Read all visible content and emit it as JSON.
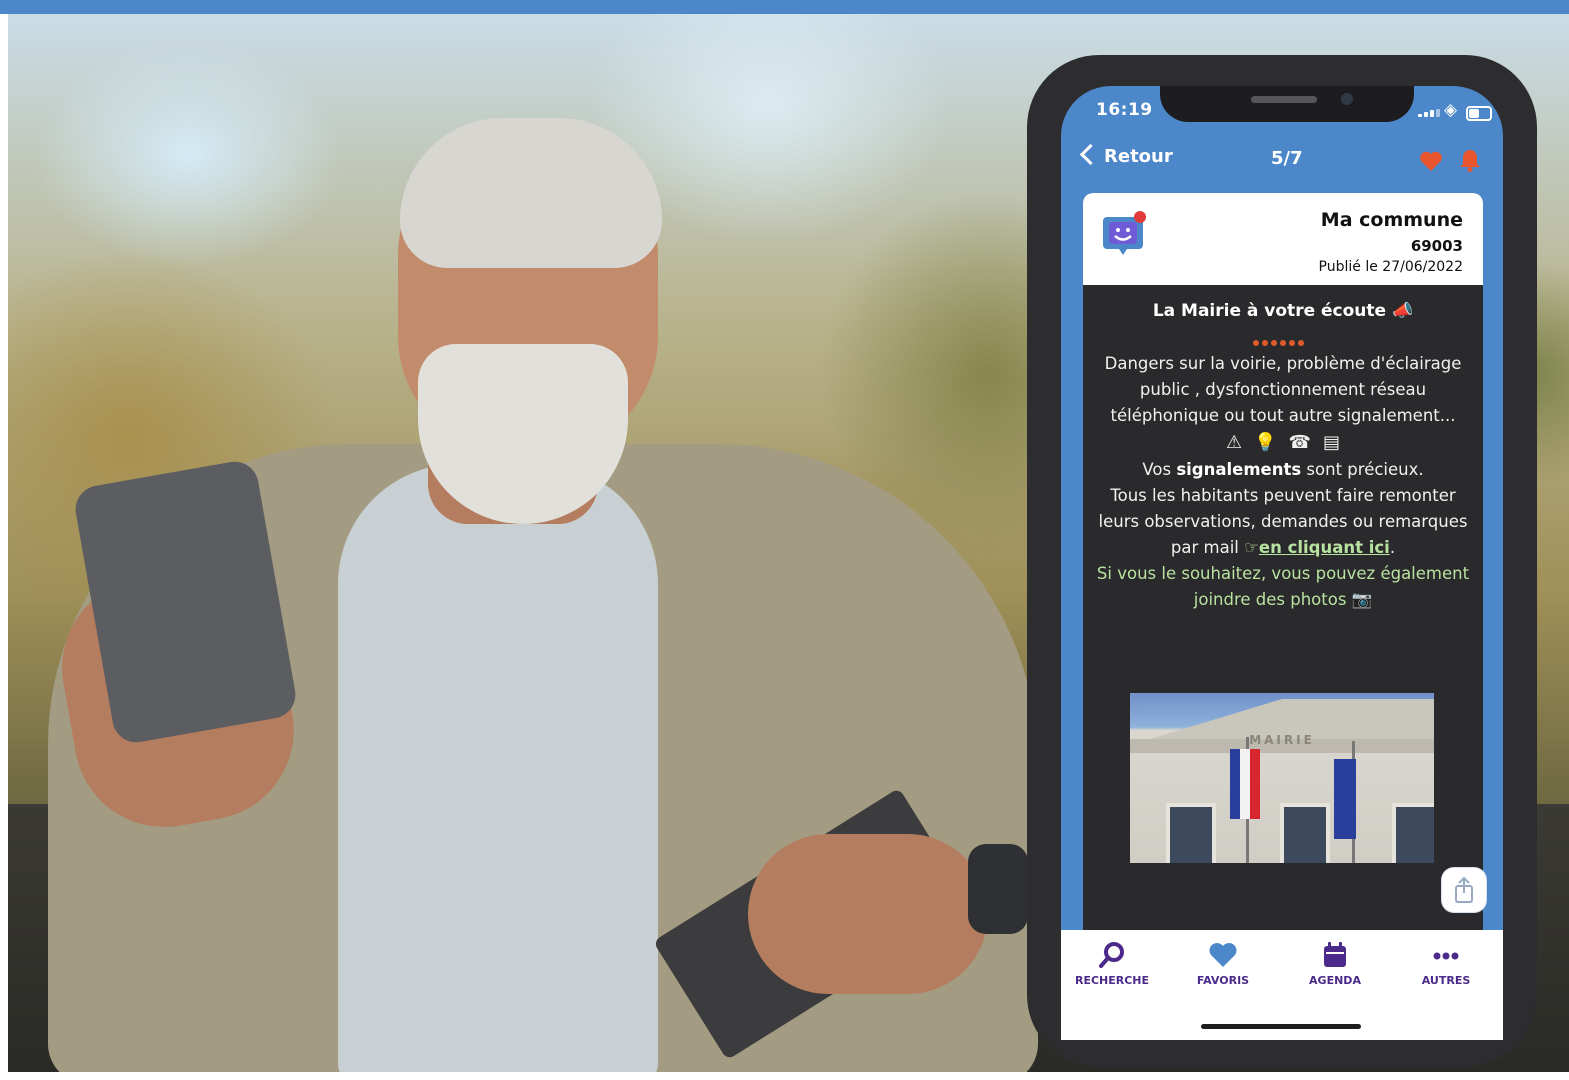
{
  "status_bar": {
    "time": "16:19"
  },
  "nav": {
    "back_label": "Retour",
    "page_count": "5/7"
  },
  "post": {
    "commune_name": "Ma commune",
    "commune_code": "69003",
    "published": "Publié le 27/06/2022",
    "title": "La Mairie à votre écoute",
    "body": {
      "p1": "Dangers sur la voirie, problème d'éclairage public , dysfonctionnement réseau téléphonique ou tout autre signalement...",
      "p2a": "Vos ",
      "p2b": "signalements",
      "p2c": " sont précieux.",
      "p3": "Tous les habitants peuvent faire remonter leurs observations, demandes ou remarques par mail ",
      "p3_link": "en cliquant ici",
      "p4": "Si vous le souhaitez, vous pouvez également joindre des photos"
    },
    "photo_text": "MAIRIE"
  },
  "tabbar": {
    "search": "RECHERCHE",
    "favorites": "FAVORIS",
    "agenda": "AGENDA",
    "more": "AUTRES"
  },
  "colors": {
    "brand_blue": "#4b87c9",
    "tab_purple": "#4b2a8a",
    "heart_orange": "#e8552f"
  }
}
